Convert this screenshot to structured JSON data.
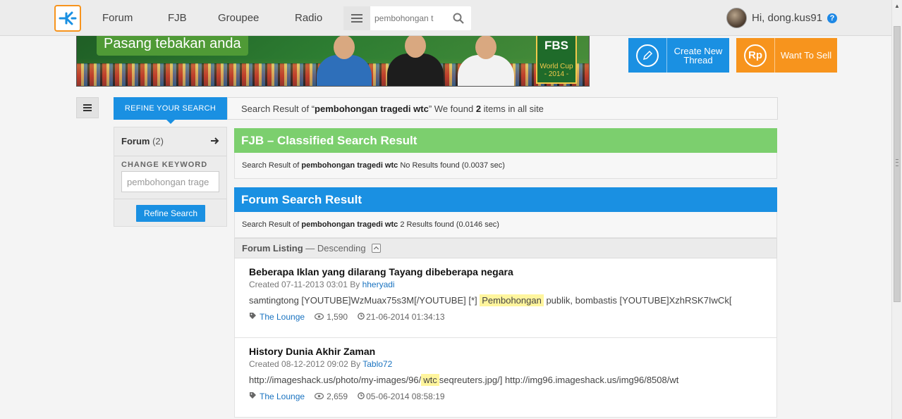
{
  "nav": {
    "items": [
      "Forum",
      "FJB",
      "Groupee",
      "Radio"
    ],
    "search_value": "pembohongan t",
    "user_greeting": "Hi, dong.kus91",
    "help_glyph": "?"
  },
  "banner": {
    "tagline": "Pasang tebakan anda",
    "brand": "FBS",
    "event_line1": "World Cup",
    "event_line2": "- 2014 -"
  },
  "actions": {
    "create_label": "Create New Thread",
    "sell_label": "Want To Sell",
    "sell_glyph": "Rp"
  },
  "refine": {
    "tab_label": "REFINE YOUR SEARCH",
    "forum_label": "Forum",
    "forum_count": "(2)",
    "change_keyword_label": "CHANGE KEYWORD",
    "keyword_value": "pembohongan trage",
    "button_label": "Refine Search"
  },
  "summary": {
    "prefix": "Search Result of “",
    "query": "pembohongan tragedi wtc",
    "middle": "” We found ",
    "count": "2",
    "suffix": " items in all site"
  },
  "fjb": {
    "title": "FJB – Classified Search Result",
    "info_prefix": "Search Result of ",
    "info_query": "pembohongan tragedi wtc",
    "info_suffix": " No Results found (0.0037 sec)"
  },
  "forum": {
    "title": "Forum Search Result",
    "info_prefix": "Search Result of ",
    "info_query": "pembohongan tragedi wtc",
    "info_suffix": " 2 Results found (0.0146 sec)",
    "listing_label": "Forum Listing",
    "listing_order": " — Descending"
  },
  "results": [
    {
      "title": "Beberapa Iklan yang dilarang Tayang dibeberapa negara",
      "created": "Created 07-11-2013 03:01 By ",
      "author": "hheryadi",
      "snip_before": "samtingtong [YOUTUBE]WzMuax75s3M[/YOUTUBE] [*] ",
      "snip_hl": "Pembohongan",
      "snip_after": " publik, bombastis [YOUTUBE]XzhRSK7IwCk[",
      "category": "The Lounge",
      "views": "1,590",
      "last_post": "21-06-2014 01:34:13"
    },
    {
      "title": "History Dunia Akhir Zaman",
      "created": "Created 08-12-2012 09:02 By ",
      "author": "Tablo72",
      "snip_before": "http://imageshack.us/photo/my-images/96/",
      "snip_hl": "wtc",
      "snip_after": "seqreuters.jpg/] http://img96.imageshack.us/img96/8508/wt",
      "category": "The Lounge",
      "views": "2,659",
      "last_post": "05-06-2014 08:58:19"
    }
  ],
  "icons": {
    "logo": "kaskus-logo-icon",
    "menu": "menu-icon",
    "search": "search-icon",
    "help": "help-icon",
    "pencil": "pencil-icon",
    "rupiah": "rupiah-icon",
    "arrow": "arrow-right-icon",
    "tag": "tag-icon",
    "eye": "eye-icon",
    "clock": "clock-icon"
  },
  "colors": {
    "brand_blue": "#1a90e2",
    "brand_orange": "#f7941d",
    "fjb_green": "#7ccf6e",
    "highlight": "#fff59d"
  }
}
